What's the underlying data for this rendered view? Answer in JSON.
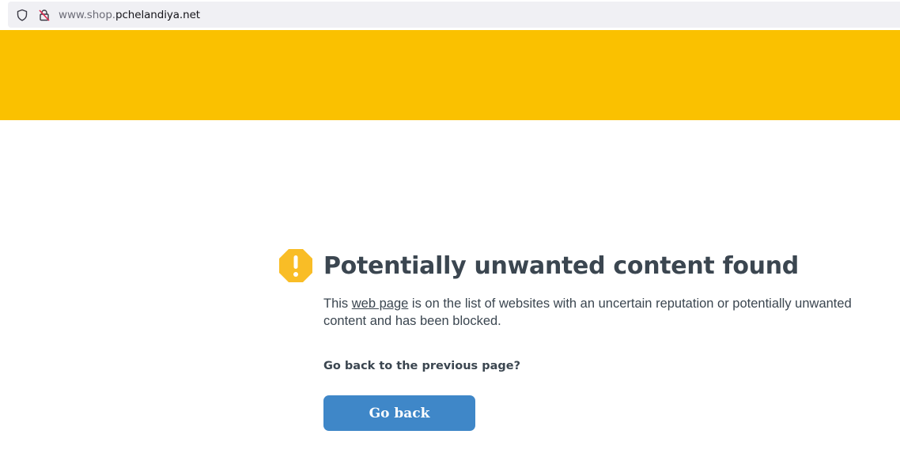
{
  "browser": {
    "url_subdomain": "www.shop.",
    "url_domain": "pchelandiya.net",
    "shield_icon": "shield-icon",
    "lock_icon": "insecure-lock-icon"
  },
  "banner": {
    "color": "#fac100"
  },
  "warning": {
    "icon": "warning-octagon-icon",
    "icon_color": "#f9bd26",
    "title": "Potentially unwanted content found",
    "desc_before": "This ",
    "desc_link": "web page",
    "desc_after": " is on the list of websites with an uncertain reputation or potentially unwanted content and has been blocked.",
    "question": "Go back to the previous page?",
    "button_label": "Go back",
    "button_color": "#3f87c8"
  }
}
